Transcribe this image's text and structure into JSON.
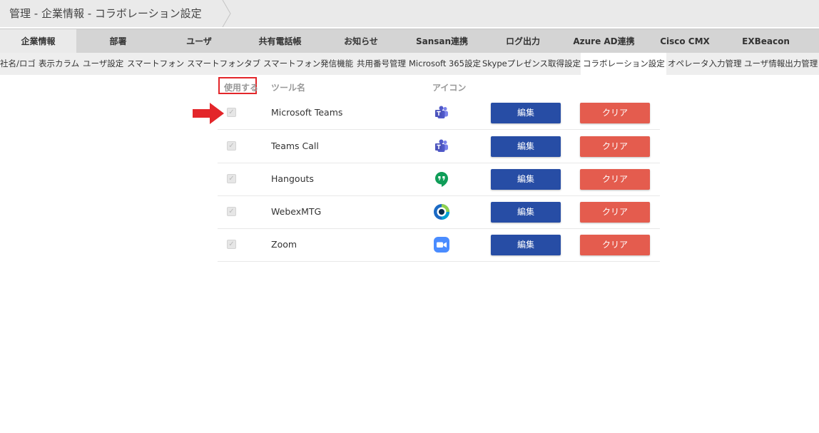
{
  "breadcrumb": {
    "title": "管理 - 企業情報 - コラボレーション設定"
  },
  "main_tabs": [
    {
      "label": "企業情報",
      "active": true
    },
    {
      "label": "部署"
    },
    {
      "label": "ユーザ"
    },
    {
      "label": "共有電話帳"
    },
    {
      "label": "お知らせ"
    },
    {
      "label": "Sansan連携"
    },
    {
      "label": "ログ出力"
    },
    {
      "label": "Azure AD連携"
    },
    {
      "label": "Cisco CMX"
    },
    {
      "label": "EXBeacon"
    }
  ],
  "sub_tabs": [
    {
      "label": "社名/ロゴ"
    },
    {
      "label": "表示カラム"
    },
    {
      "label": "ユーザ設定"
    },
    {
      "label": "スマートフォン"
    },
    {
      "label": "スマートフォンタブ"
    },
    {
      "label": "スマートフォン発信機能"
    },
    {
      "label": "共用番号管理"
    },
    {
      "label": "Microsoft 365設定"
    },
    {
      "label": "Skypeプレゼンス取得設定"
    },
    {
      "label": "コラボレーション設定",
      "active": true
    },
    {
      "label": "オペレータ入力管理"
    },
    {
      "label": "ユーザ情報出力管理"
    }
  ],
  "table": {
    "headers": {
      "use": "使用する",
      "tool_name": "ツール名",
      "icon": "アイコン"
    },
    "rows": [
      {
        "name": "Microsoft Teams",
        "icon": "teams-icon",
        "checked": true,
        "edit": "編集",
        "clear": "クリア"
      },
      {
        "name": "Teams Call",
        "icon": "teams-icon",
        "checked": true,
        "edit": "編集",
        "clear": "クリア"
      },
      {
        "name": "Hangouts",
        "icon": "hangouts-icon",
        "checked": true,
        "edit": "編集",
        "clear": "クリア"
      },
      {
        "name": "WebexMTG",
        "icon": "webex-icon",
        "checked": true,
        "edit": "編集",
        "clear": "クリア"
      },
      {
        "name": "Zoom",
        "icon": "zoom-icon",
        "checked": true,
        "edit": "編集",
        "clear": "クリア"
      }
    ]
  },
  "colors": {
    "edit_button": "#274da5",
    "clear_button": "#e45c4e",
    "highlight": "#e3262a"
  }
}
